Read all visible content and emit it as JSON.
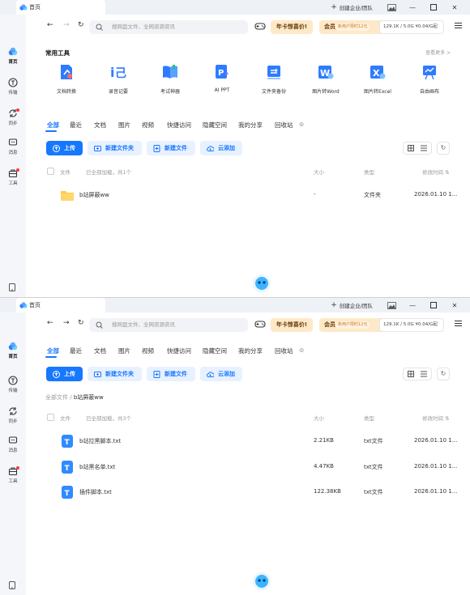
{
  "tab_title": "首页",
  "titlebar": {
    "enterprise": "创建企业/团队"
  },
  "sidebar": [
    {
      "label": "首页",
      "icon": "cloud-icon"
    },
    {
      "label": "传输",
      "icon": "transfer-icon"
    },
    {
      "label": "同步",
      "icon": "sync-icon"
    },
    {
      "label": "消息",
      "icon": "message-icon"
    },
    {
      "label": "工具",
      "icon": "toolbox-icon"
    }
  ],
  "search": {
    "placeholder": "搜网盘文件、全网资源资讯"
  },
  "promo": "年卡惊喜价!",
  "vip": {
    "label": "会员",
    "badge": "新用户限时12元"
  },
  "storage": {
    "text": "129.1K / 5.0G  ¥0.04/G起"
  },
  "tools_section": {
    "title": "常用工具",
    "more": "查看更多 >"
  },
  "tools": [
    {
      "label": "文档转换",
      "icon": "doc-convert-icon"
    },
    {
      "label": "录音记要",
      "icon": "recording-icon"
    },
    {
      "label": "考试神器",
      "icon": "exam-book-icon"
    },
    {
      "label": "AI PPT",
      "icon": "ai-ppt-icon"
    },
    {
      "label": "文件夹备份",
      "icon": "folder-backup-icon"
    },
    {
      "label": "图片转Word",
      "icon": "image-to-word-icon"
    },
    {
      "label": "图片转Excel",
      "icon": "image-to-excel-icon"
    },
    {
      "label": "自由画布",
      "icon": "canvas-icon"
    }
  ],
  "filter_tabs": [
    "全部",
    "最近",
    "文档",
    "图片",
    "视频",
    "快捷访问",
    "隐藏空间",
    "我的分享",
    "回收站"
  ],
  "actions": {
    "upload": "上传",
    "new_folder": "新建文件夹",
    "new_file": "新建文件",
    "cloud_add": "云添加"
  },
  "table_header": {
    "file": "文件",
    "size": "大小",
    "type": "类型",
    "modified": "修改时间"
  },
  "pane1": {
    "loaded": "已全部加载，共1个",
    "rows": [
      {
        "name": "b站屏蔽ww",
        "size": "-",
        "type": "文件夹",
        "date": "2026.01.10 1..."
      }
    ]
  },
  "pane2": {
    "breadcrumb_root": "全部文件",
    "breadcrumb_sep": "/",
    "breadcrumb_current": "b站屏蔽ww",
    "loaded": "已全部加载，共3个",
    "rows": [
      {
        "name": "b站拉黑脚本.txt",
        "size": "2.21KB",
        "type": "txt文件",
        "date": "2026.01.10 1..."
      },
      {
        "name": "b站黑名单.txt",
        "size": "4.47KB",
        "type": "txt文件",
        "date": "2026.01.10 1..."
      },
      {
        "name": "插件脚本.txt",
        "size": "122.38KB",
        "type": "txt文件",
        "date": "2026.01.10 1..."
      }
    ]
  },
  "colors": {
    "accent": "#1677ff",
    "promo_bg": "#fde9c8",
    "badge_red": "#f03c46"
  }
}
